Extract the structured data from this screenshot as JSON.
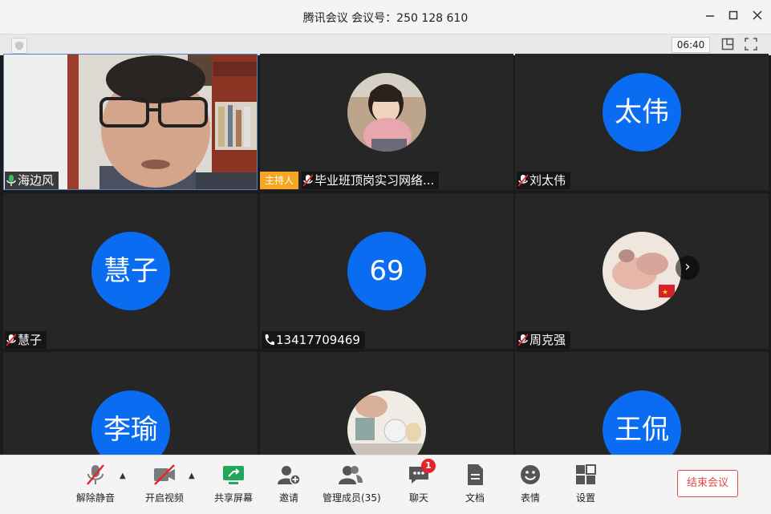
{
  "window": {
    "title": "腾讯会议 会议号：250 128 610",
    "timer": "06:40"
  },
  "participants": [
    {
      "name": "海边风",
      "type": "video"
    },
    {
      "name": "毕业班顶岗实习网络...",
      "type": "photo",
      "host_label": "主持人"
    },
    {
      "name": "刘太伟",
      "avatar_text": "太伟"
    },
    {
      "name": "慧子",
      "avatar_text": "慧子"
    },
    {
      "name": "13417709469",
      "avatar_text": "69",
      "phone": true
    },
    {
      "name": "周克强",
      "type": "photo"
    },
    {
      "name": "",
      "avatar_text": "李瑜"
    },
    {
      "name": "",
      "type": "photo"
    },
    {
      "name": "",
      "avatar_text": "王侃"
    }
  ],
  "toolbar": {
    "unmute": "解除静音",
    "start_video": "开启视频",
    "share_screen": "共享屏幕",
    "invite": "邀请",
    "manage_members": "管理成员(35)",
    "chat": "聊天",
    "chat_badge": "1",
    "docs": "文档",
    "emoji": "表情",
    "settings": "设置",
    "end_meeting": "结束会议"
  },
  "colors": {
    "avatar_blue": "#0a6cf0",
    "host_orange": "#f6a623",
    "end_red": "#e5484d",
    "badge_red": "#e6222b"
  }
}
